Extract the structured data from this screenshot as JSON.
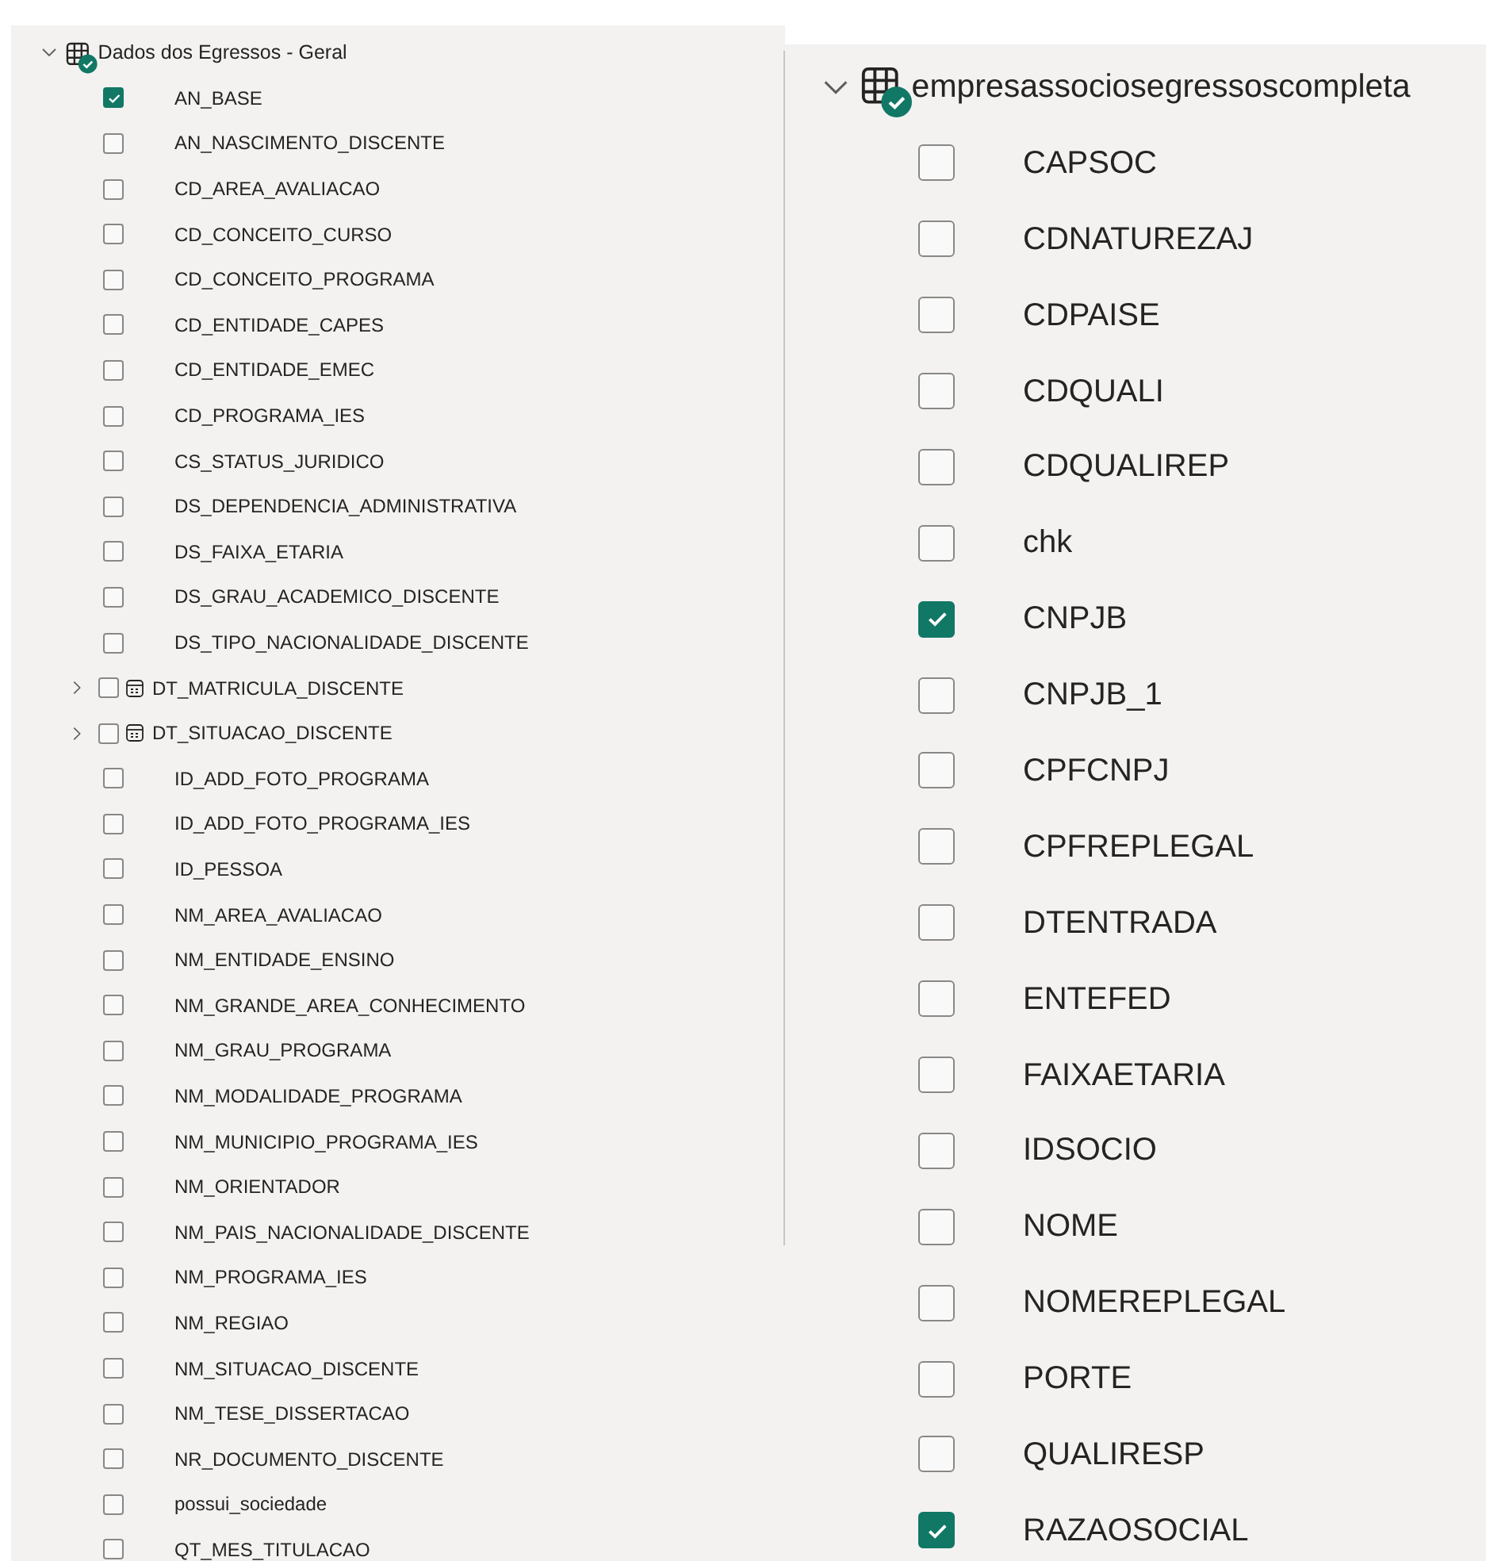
{
  "tables": [
    {
      "name": "Dados dos Egressos - Geral",
      "expanded": true,
      "fields": [
        {
          "kind": "field",
          "name": "AN_BASE",
          "checked": true
        },
        {
          "kind": "field",
          "name": "AN_NASCIMENTO_DISCENTE",
          "checked": false
        },
        {
          "kind": "field",
          "name": "CD_AREA_AVALIACAO",
          "checked": false
        },
        {
          "kind": "field",
          "name": "CD_CONCEITO_CURSO",
          "checked": false
        },
        {
          "kind": "field",
          "name": "CD_CONCEITO_PROGRAMA",
          "checked": false
        },
        {
          "kind": "field",
          "name": "CD_ENTIDADE_CAPES",
          "checked": false
        },
        {
          "kind": "field",
          "name": "CD_ENTIDADE_EMEC",
          "checked": false
        },
        {
          "kind": "field",
          "name": "CD_PROGRAMA_IES",
          "checked": false
        },
        {
          "kind": "field",
          "name": "CS_STATUS_JURIDICO",
          "checked": false
        },
        {
          "kind": "field",
          "name": "DS_DEPENDENCIA_ADMINISTRATIVA",
          "checked": false
        },
        {
          "kind": "field",
          "name": "DS_FAIXA_ETARIA",
          "checked": false
        },
        {
          "kind": "field",
          "name": "DS_GRAU_ACADEMICO_DISCENTE",
          "checked": false
        },
        {
          "kind": "field",
          "name": "DS_TIPO_NACIONALIDADE_DISCENTE",
          "checked": false
        },
        {
          "kind": "hierarchy",
          "name": "DT_MATRICULA_DISCENTE",
          "checked": false,
          "expanded": false
        },
        {
          "kind": "hierarchy",
          "name": "DT_SITUACAO_DISCENTE",
          "checked": false,
          "expanded": false
        },
        {
          "kind": "field",
          "name": "ID_ADD_FOTO_PROGRAMA",
          "checked": false
        },
        {
          "kind": "field",
          "name": "ID_ADD_FOTO_PROGRAMA_IES",
          "checked": false
        },
        {
          "kind": "field",
          "name": "ID_PESSOA",
          "checked": false
        },
        {
          "kind": "field",
          "name": "NM_AREA_AVALIACAO",
          "checked": false
        },
        {
          "kind": "field",
          "name": "NM_ENTIDADE_ENSINO",
          "checked": false
        },
        {
          "kind": "field",
          "name": "NM_GRANDE_AREA_CONHECIMENTO",
          "checked": false
        },
        {
          "kind": "field",
          "name": "NM_GRAU_PROGRAMA",
          "checked": false
        },
        {
          "kind": "field",
          "name": "NM_MODALIDADE_PROGRAMA",
          "checked": false
        },
        {
          "kind": "field",
          "name": "NM_MUNICIPIO_PROGRAMA_IES",
          "checked": false
        },
        {
          "kind": "field",
          "name": "NM_ORIENTADOR",
          "checked": false
        },
        {
          "kind": "field",
          "name": "NM_PAIS_NACIONALIDADE_DISCENTE",
          "checked": false
        },
        {
          "kind": "field",
          "name": "NM_PROGRAMA_IES",
          "checked": false
        },
        {
          "kind": "field",
          "name": "NM_REGIAO",
          "checked": false
        },
        {
          "kind": "field",
          "name": "NM_SITUACAO_DISCENTE",
          "checked": false
        },
        {
          "kind": "field",
          "name": "NM_TESE_DISSERTACAO",
          "checked": false
        },
        {
          "kind": "field",
          "name": "NR_DOCUMENTO_DISCENTE",
          "checked": false
        },
        {
          "kind": "field",
          "name": "possui_sociedade",
          "checked": false
        },
        {
          "kind": "field",
          "name": "QT_MES_TITULACAO",
          "checked": false
        }
      ]
    },
    {
      "name": "empresassociosegressoscompleta",
      "expanded": true,
      "fields": [
        {
          "kind": "field",
          "name": "CAPSOC",
          "checked": false
        },
        {
          "kind": "field",
          "name": "CDNATUREZAJ",
          "checked": false
        },
        {
          "kind": "field",
          "name": "CDPAISE",
          "checked": false
        },
        {
          "kind": "field",
          "name": "CDQUALI",
          "checked": false
        },
        {
          "kind": "field",
          "name": "CDQUALIREP",
          "checked": false
        },
        {
          "kind": "field",
          "name": "chk",
          "checked": false
        },
        {
          "kind": "field",
          "name": "CNPJB",
          "checked": true
        },
        {
          "kind": "field",
          "name": "CNPJB_1",
          "checked": false
        },
        {
          "kind": "field",
          "name": "CPFCNPJ",
          "checked": false
        },
        {
          "kind": "field",
          "name": "CPFREPLEGAL",
          "checked": false
        },
        {
          "kind": "field",
          "name": "DTENTRADA",
          "checked": false
        },
        {
          "kind": "field",
          "name": "ENTEFED",
          "checked": false
        },
        {
          "kind": "field",
          "name": "FAIXAETARIA",
          "checked": false
        },
        {
          "kind": "field",
          "name": "IDSOCIO",
          "checked": false
        },
        {
          "kind": "field",
          "name": "NOME",
          "checked": false
        },
        {
          "kind": "field",
          "name": "NOMEREPLEGAL",
          "checked": false
        },
        {
          "kind": "field",
          "name": "PORTE",
          "checked": false
        },
        {
          "kind": "field",
          "name": "QUALIRESP",
          "checked": false
        },
        {
          "kind": "field",
          "name": "RAZAOSOCIAL",
          "checked": true
        }
      ]
    }
  ]
}
